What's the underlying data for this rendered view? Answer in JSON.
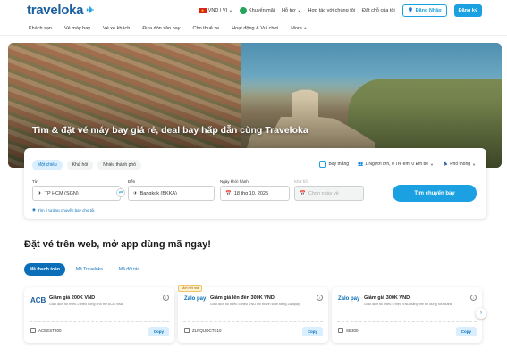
{
  "header": {
    "logo": "traveloka",
    "currency_lang": "VND | VI",
    "promo_label": "Khuyến mãi",
    "support_label": "Hỗ trợ",
    "partner_label": "Hợp tác với chúng tôi",
    "bookings_label": "Đặt chỗ của tôi",
    "login_label": "Đăng Nhập",
    "signup_label": "Đăng ký"
  },
  "nav": {
    "items": [
      "Khách sạn",
      "Vé máy bay",
      "Vé xe khách",
      "Đưa đón sân bay",
      "Cho thuê xe",
      "Hoạt động & Vui chơi",
      "More"
    ]
  },
  "hero": {
    "tagline": "Tìm & đặt vé máy bay giá rẻ, deal bay hấp dẫn cùng Traveloka"
  },
  "search": {
    "trip_types": [
      "Một chiều",
      "Khứ hồi",
      "Nhiều thành phố"
    ],
    "option_flexible": "Bay thẳng",
    "option_passengers": "1 Người lớn, 0 Trẻ em, 0 Em bé",
    "option_class": "Phổ thông",
    "from_label": "Từ",
    "from_value": "TP HCM (SGN)",
    "to_label": "Đến",
    "to_value": "Bangkok (BKKA)",
    "depart_label": "Ngày khởi hành",
    "depart_value": "18 thg 10, 2025",
    "return_label": "Khứ hồi",
    "return_placeholder": "Chọn ngày về",
    "search_button": "Tìm chuyến bay",
    "multi_city_link": "Tìm ý tưởng chuyến bay cho tôi"
  },
  "promo": {
    "title": "Đặt vé trên web, mở app dùng mã ngay!",
    "tabs": [
      "Mã thanh toán",
      "Mã Traveloka",
      "Mã đối tác"
    ],
    "new_badge": "Mới hết mã",
    "coupons": [
      {
        "brand": "ACB",
        "title": "Giảm giá 200K VND",
        "desc": "Giao dịch tối thiểu 2 triệu đồng cho thẻ ACB Visa",
        "code": "ACBEST200",
        "copy_label": "Copy"
      },
      {
        "brand": "Zalo pay",
        "title": "Giảm giá lên đến 300K VND",
        "desc": "Giao dịch tối thiểu 5 triệu VND khi thanh toán bằng Zalopay",
        "code": "ZLPQUOCTE10",
        "copy_label": "Copy"
      },
      {
        "brand": "Zalo pay",
        "title": "Giảm giá 300K VND",
        "desc": "Giao dịch tối thiểu 5 triệu VND bằng thẻ tín dụng SeABank",
        "code": "SB300",
        "copy_label": "Copy"
      }
    ]
  }
}
